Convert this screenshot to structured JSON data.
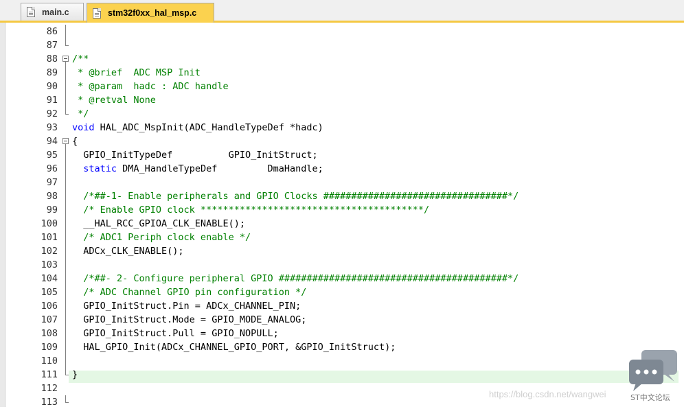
{
  "tabs": [
    {
      "label": "main.c",
      "active": false
    },
    {
      "label": "stm32f0xx_hal_msp.c",
      "active": true
    }
  ],
  "lines": [
    {
      "num": "86",
      "tokens": []
    },
    {
      "num": "87",
      "tokens": []
    },
    {
      "num": "88",
      "tokens": [
        {
          "t": "/**",
          "c": "c"
        }
      ]
    },
    {
      "num": "89",
      "tokens": [
        {
          "t": " * @brief  ADC MSP Init",
          "c": "c"
        }
      ]
    },
    {
      "num": "90",
      "tokens": [
        {
          "t": " * @param  hadc : ADC handle",
          "c": "c"
        }
      ]
    },
    {
      "num": "91",
      "tokens": [
        {
          "t": " * @retval None",
          "c": "c"
        }
      ]
    },
    {
      "num": "92",
      "tokens": [
        {
          "t": " */",
          "c": "c"
        }
      ]
    },
    {
      "num": "93",
      "tokens": [
        {
          "t": "void",
          "c": "k"
        },
        {
          "t": " HAL_ADC_MspInit(ADC_HandleTypeDef *hadc)",
          "c": "d"
        }
      ]
    },
    {
      "num": "94",
      "tokens": [
        {
          "t": "{",
          "c": "d"
        }
      ]
    },
    {
      "num": "95",
      "tokens": [
        {
          "t": "  GPIO_InitTypeDef          GPIO_InitStruct;",
          "c": "d"
        }
      ]
    },
    {
      "num": "96",
      "tokens": [
        {
          "t": "  ",
          "c": "d"
        },
        {
          "t": "static",
          "c": "k"
        },
        {
          "t": " DMA_HandleTypeDef         DmaHandle;",
          "c": "d"
        }
      ]
    },
    {
      "num": "97",
      "tokens": []
    },
    {
      "num": "98",
      "tokens": [
        {
          "t": "  /*##-1- Enable peripherals and GPIO Clocks #################################*/",
          "c": "c"
        }
      ]
    },
    {
      "num": "99",
      "tokens": [
        {
          "t": "  /* Enable GPIO clock ****************************************/",
          "c": "c"
        }
      ]
    },
    {
      "num": "100",
      "tokens": [
        {
          "t": "  __HAL_RCC_GPIOA_CLK_ENABLE();",
          "c": "d"
        }
      ]
    },
    {
      "num": "101",
      "tokens": [
        {
          "t": "  /* ADC1 Periph clock enable */",
          "c": "c"
        }
      ]
    },
    {
      "num": "102",
      "tokens": [
        {
          "t": "  ADCx_CLK_ENABLE();",
          "c": "d"
        }
      ]
    },
    {
      "num": "103",
      "tokens": []
    },
    {
      "num": "104",
      "tokens": [
        {
          "t": "  /*##- 2- Configure peripheral GPIO #########################################*/",
          "c": "c"
        }
      ]
    },
    {
      "num": "105",
      "tokens": [
        {
          "t": "  /* ADC Channel GPIO pin configuration */",
          "c": "c"
        }
      ]
    },
    {
      "num": "106",
      "tokens": [
        {
          "t": "  GPIO_InitStruct.Pin = ADCx_CHANNEL_PIN;",
          "c": "d"
        }
      ]
    },
    {
      "num": "107",
      "tokens": [
        {
          "t": "  GPIO_InitStruct.Mode = GPIO_MODE_ANALOG;",
          "c": "d"
        }
      ]
    },
    {
      "num": "108",
      "tokens": [
        {
          "t": "  GPIO_InitStruct.Pull = GPIO_NOPULL;",
          "c": "d"
        }
      ]
    },
    {
      "num": "109",
      "tokens": [
        {
          "t": "  HAL_GPIO_Init(ADCx_CHANNEL_GPIO_PORT, &GPIO_InitStruct);",
          "c": "d"
        }
      ]
    },
    {
      "num": "110",
      "tokens": []
    },
    {
      "num": "111",
      "tokens": [
        {
          "t": "}",
          "c": "d"
        }
      ]
    },
    {
      "num": "112",
      "tokens": []
    },
    {
      "num": "113",
      "tokens": []
    }
  ],
  "watermark": {
    "url_text": "https://blog.csdn.net/wangwei",
    "logo_label": "ST中文论坛"
  },
  "colors": {
    "comment": "#008000",
    "keyword": "#0000ff",
    "active_tab": "#fbd24f"
  }
}
